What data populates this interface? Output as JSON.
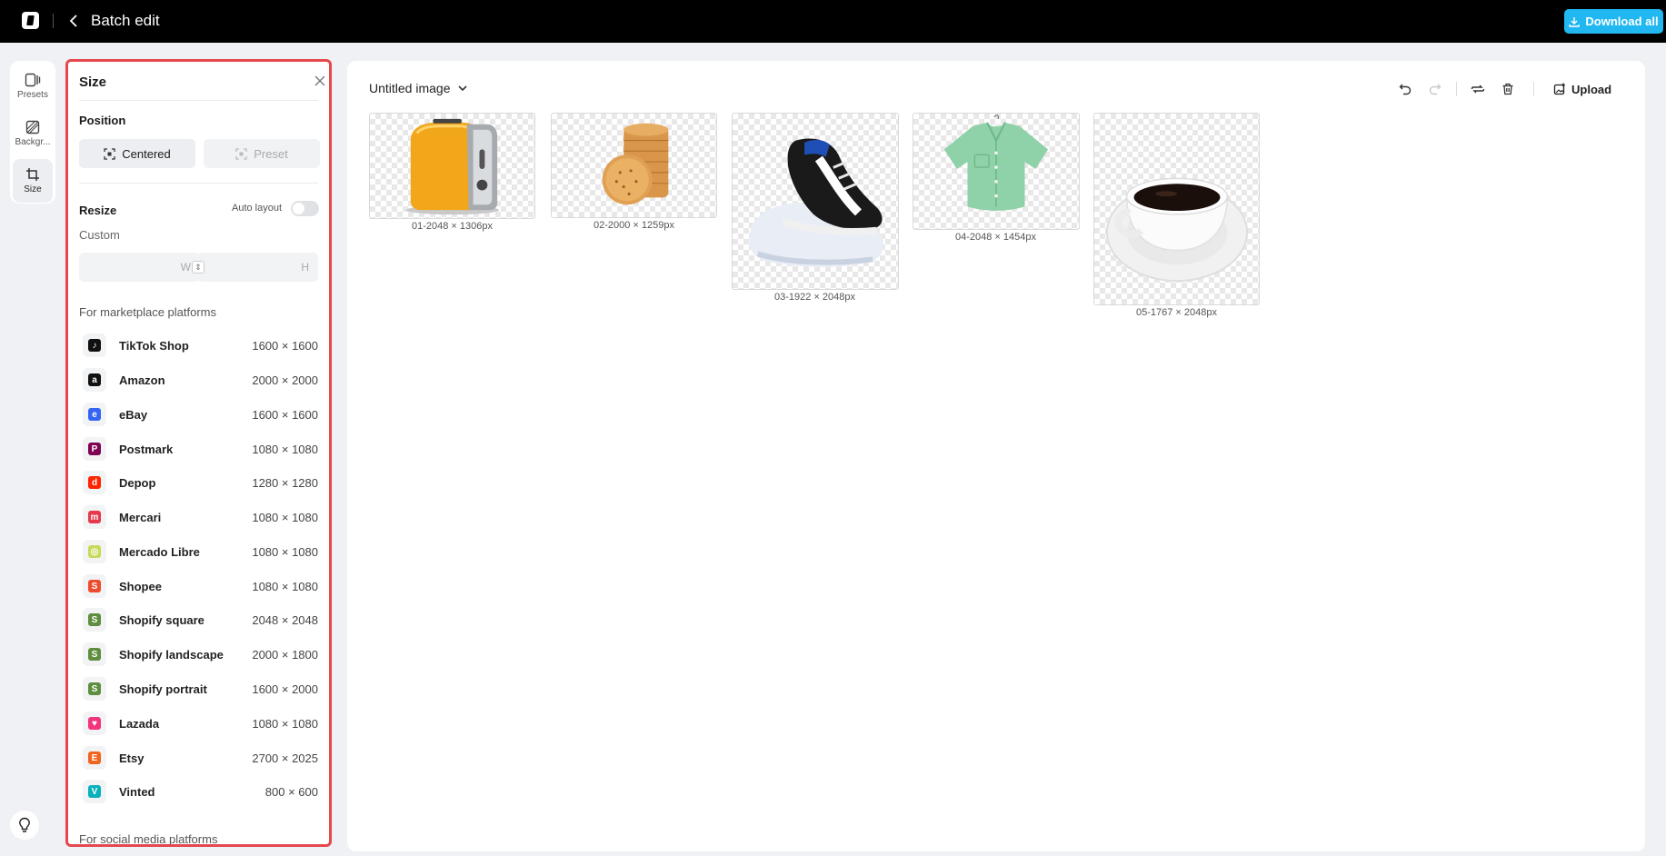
{
  "topbar": {
    "title": "Batch edit",
    "download_label": "Download all"
  },
  "rail": {
    "items": [
      {
        "label": "Presets",
        "icon": "presets-icon"
      },
      {
        "label": "Backgr...",
        "icon": "background-icon"
      },
      {
        "label": "Size",
        "icon": "crop-icon"
      }
    ]
  },
  "panel": {
    "title": "Size",
    "position_heading": "Position",
    "centered_label": "Centered",
    "preset_label": "Preset",
    "resize_heading": "Resize",
    "auto_layout_label": "Auto layout",
    "custom_label": "Custom",
    "width_placeholder": "W",
    "height_placeholder": "H",
    "marketplace_heading": "For marketplace platforms",
    "social_heading": "For social media platforms",
    "platforms": [
      {
        "name": "TikTok Shop",
        "dims": "1600 × 1600",
        "color": "#111111",
        "glyph": "♪"
      },
      {
        "name": "Amazon",
        "dims": "2000 × 2000",
        "color": "#111111",
        "glyph": "a"
      },
      {
        "name": "eBay",
        "dims": "1600 × 1600",
        "color": "#3665f3",
        "glyph": "e"
      },
      {
        "name": "Postmark",
        "dims": "1080 × 1080",
        "color": "#7f0353",
        "glyph": "P"
      },
      {
        "name": "Depop",
        "dims": "1280 × 1280",
        "color": "#ff2300",
        "glyph": "d"
      },
      {
        "name": "Mercari",
        "dims": "1080 × 1080",
        "color": "#e6394b",
        "glyph": "m"
      },
      {
        "name": "Mercado Libre",
        "dims": "1080 × 1080",
        "color": "#c9d95a",
        "glyph": "◎"
      },
      {
        "name": "Shopee",
        "dims": "1080 × 1080",
        "color": "#ee4d2d",
        "glyph": "S"
      },
      {
        "name": "Shopify square",
        "dims": "2048 × 2048",
        "color": "#5e8e3e",
        "glyph": "S"
      },
      {
        "name": "Shopify landscape",
        "dims": "2000 × 1800",
        "color": "#5e8e3e",
        "glyph": "S"
      },
      {
        "name": "Shopify portrait",
        "dims": "1600 × 2000",
        "color": "#5e8e3e",
        "glyph": "S"
      },
      {
        "name": "Lazada",
        "dims": "1080 × 1080",
        "color": "#f3357e",
        "glyph": "♥"
      },
      {
        "name": "Etsy",
        "dims": "2700 × 2025",
        "color": "#f1641e",
        "glyph": "E"
      },
      {
        "name": "Vinted",
        "dims": "800 × 600",
        "color": "#09b1ba",
        "glyph": "V"
      }
    ]
  },
  "canvas": {
    "image_name": "Untitled image",
    "upload_label": "Upload",
    "images": [
      {
        "caption": "01-2048 × 1306px",
        "subject": "toaster"
      },
      {
        "caption": "02-2000 × 1259px",
        "subject": "crackers"
      },
      {
        "caption": "03-1922 × 2048px",
        "subject": "sneaker"
      },
      {
        "caption": "04-2048 × 1454px",
        "subject": "shirt"
      },
      {
        "caption": "05-1767 × 2048px",
        "subject": "coffee-cup"
      }
    ]
  },
  "colors": {
    "accent": "#21b7f0",
    "highlight_border": "#e5484d",
    "topbar": "#000000"
  }
}
